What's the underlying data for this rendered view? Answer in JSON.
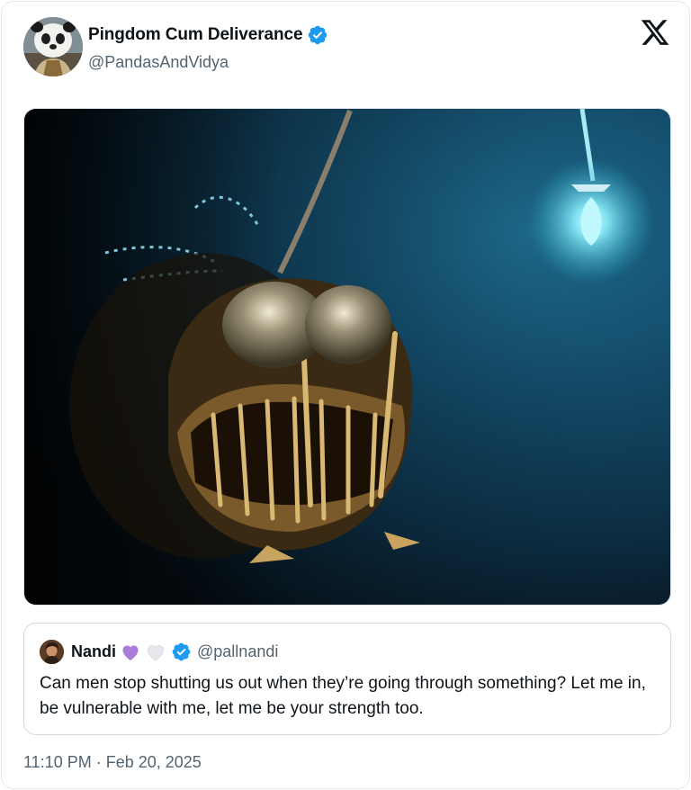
{
  "tweet": {
    "author": {
      "display_name": "Pingdom Cum Deliverance",
      "handle": "@PandasAndVidya",
      "verified": true,
      "avatar_icon": "panda-avatar"
    },
    "platform_icon": "x-logo-icon",
    "media": {
      "description_icon": "anglerfish-image"
    },
    "quoted_tweet": {
      "display_name": "Nandi",
      "emoji": [
        "purple-heart",
        "white-heart"
      ],
      "handle": "@pallnandi",
      "verified": true,
      "text": "Can men stop shutting us out when they’re going through something? Let me in, be vulnerable with me, let me be your strength too."
    },
    "timestamp": "11:10 PM · Feb 20, 2025"
  },
  "colors": {
    "verified_blue": "#1d9bf0",
    "secondary_text": "#536471",
    "primary_text": "#0f1419",
    "purple_heart": "#a97ed8",
    "white_heart": "#e6e8ee"
  }
}
